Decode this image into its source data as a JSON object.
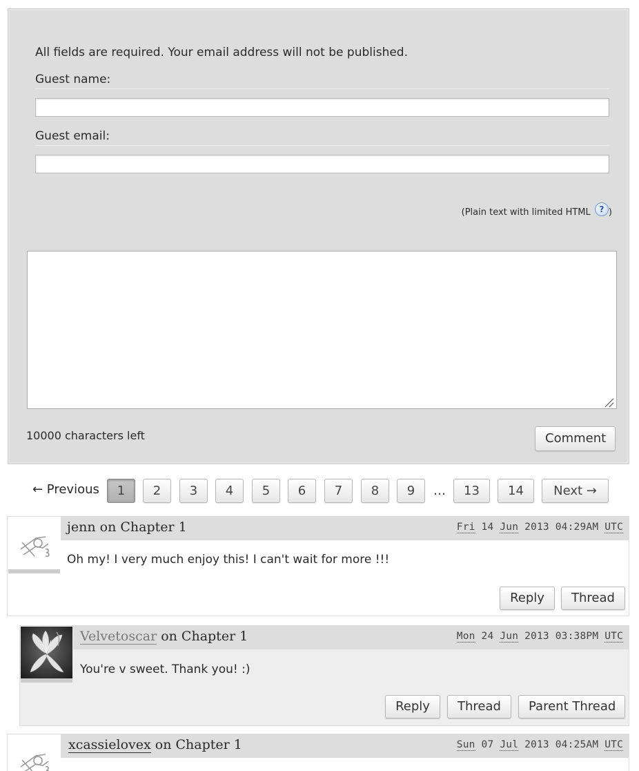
{
  "form": {
    "notice": "All fields are required. Your email address will not be published.",
    "guest_name_label": "Guest name:",
    "guest_name_value": "",
    "guest_email_label": "Guest email:",
    "guest_email_value": "",
    "html_note_prefix": "(Plain text with limited HTML",
    "html_note_suffix": ")",
    "help_icon_glyph": "?",
    "comment_value": "",
    "chars_left": "10000 characters left",
    "submit_label": "Comment"
  },
  "pagination": {
    "previous_label": "← Previous",
    "pages": [
      "1",
      "2",
      "3",
      "4",
      "5",
      "6",
      "7",
      "8",
      "9"
    ],
    "current_page": "1",
    "gap": "…",
    "last_pages": [
      "13",
      "14"
    ],
    "next_label": "Next →"
  },
  "comments": [
    {
      "user": "jenn",
      "on": "on Chapter 1",
      "posted": {
        "day": "Fri",
        "date": "14",
        "month": "Jun",
        "year": "2013",
        "time": "04:29AM",
        "tz": "UTC"
      },
      "text": "Oh my! I very much enjoy this! I can't wait for more !!!",
      "avatar": "default-avatar-icon",
      "actions": [
        "Reply",
        "Thread"
      ]
    },
    {
      "user": "Velvetoscar",
      "on": "on Chapter 1",
      "posted": {
        "day": "Mon",
        "date": "24",
        "month": "Jun",
        "year": "2013",
        "time": "03:38PM",
        "tz": "UTC"
      },
      "text": "You're v sweet. Thank you! :)",
      "avatar": "lily-flower-avatar",
      "actions": [
        "Reply",
        "Thread",
        "Parent Thread"
      ]
    },
    {
      "user": "xcassielovex",
      "on": "on Chapter 1",
      "posted": {
        "day": "Sun",
        "date": "07",
        "month": "Jul",
        "year": "2013",
        "time": "04:25AM",
        "tz": "UTC"
      },
      "text": "",
      "avatar": "default-avatar-icon",
      "actions": []
    }
  ],
  "colors": {
    "form_background": "#dddddd",
    "comment_header": "#dddddd",
    "nested_comment_background": "#eeeeee",
    "current_page": "#b8b8b8"
  }
}
